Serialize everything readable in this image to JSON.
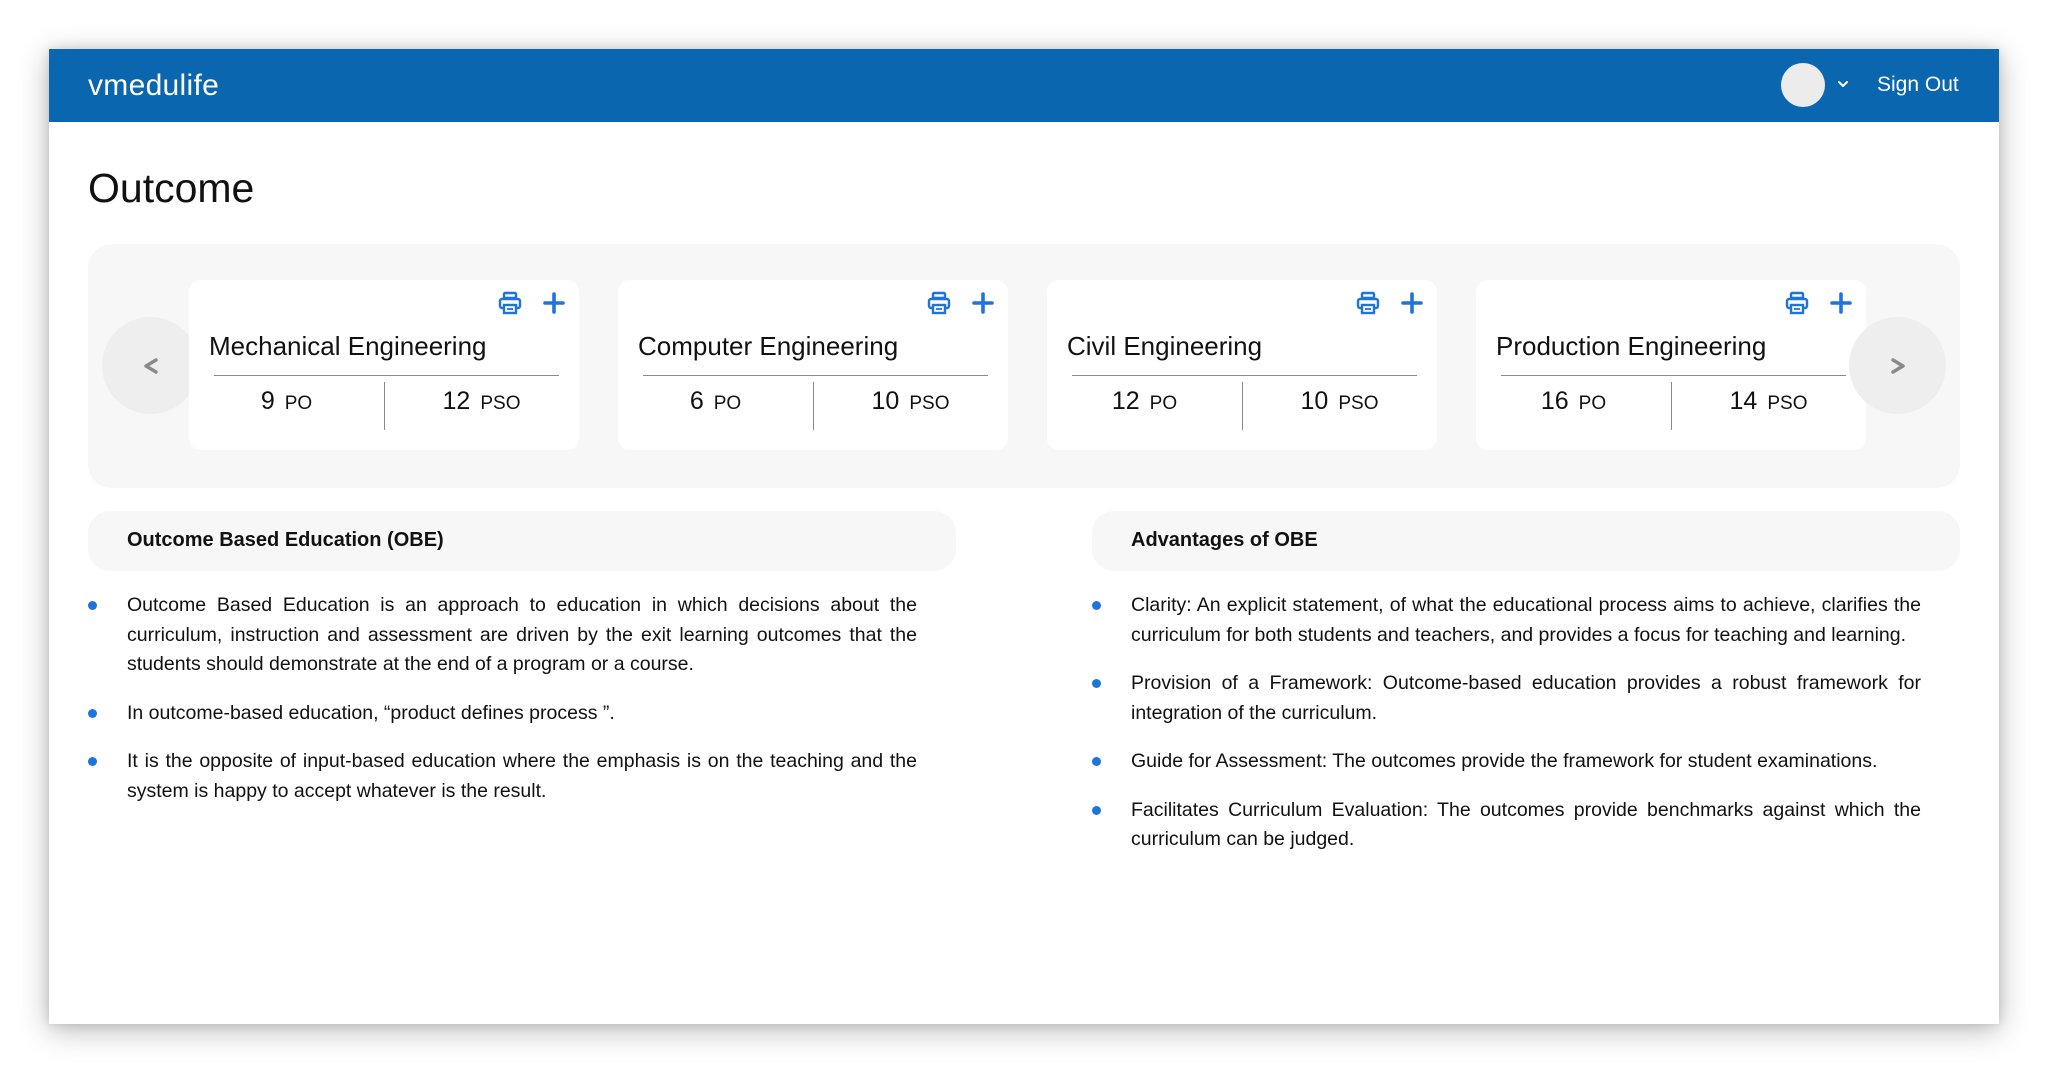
{
  "app": {
    "brand": "vmedulife"
  },
  "header": {
    "signout_label": "Sign Out",
    "avatar_icon": "user-avatar",
    "caret_icon": "chevron-down-icon"
  },
  "page": {
    "title": "Outcome"
  },
  "carousel": {
    "prev_label": "<",
    "next_label": ">",
    "cards": [
      {
        "title": "Mechanical Engineering",
        "po": "9",
        "po_label": "PO",
        "pso": "12",
        "pso_label": "PSO"
      },
      {
        "title": "Computer Engineering",
        "po": "6",
        "po_label": "PO",
        "pso": "10",
        "pso_label": "PSO"
      },
      {
        "title": "Civil Engineering",
        "po": "12",
        "po_label": "PO",
        "pso": "10",
        "pso_label": "PSO"
      },
      {
        "title": "Production Engineering",
        "po": "16",
        "po_label": "PO",
        "pso": "14",
        "pso_label": "PSO"
      }
    ]
  },
  "obe": {
    "title": "Outcome Based Education (OBE)",
    "items": [
      "Outcome Based Education is an approach to education in which decisions about the curriculum, instruction and assessment are driven by the exit learning outcomes that the students should demonstrate at the end of a program or a course.",
      "In outcome-based education, “product defines process ”.",
      "It is the opposite of input-based education where the emphasis is on the teaching and the system is happy to accept whatever is the result."
    ]
  },
  "advantages": {
    "title": "Advantages of OBE",
    "items": [
      "Clarity: An explicit statement, of what the educational process aims to achieve, clarifies the curriculum for both students and teachers, and provides a focus for teaching and learning.",
      "Provision of a Framework: Outcome-based education provides a robust framework for integration of the curriculum.",
      "Guide for Assessment: The outcomes provide the framework for student examinations.",
      "Facilitates Curriculum Evaluation: The outcomes provide benchmarks against which the curriculum can be judged."
    ]
  },
  "colors": {
    "header_bg": "#0a66ae",
    "accent": "#1f74dc",
    "panel_bg": "#f7f7f7"
  }
}
